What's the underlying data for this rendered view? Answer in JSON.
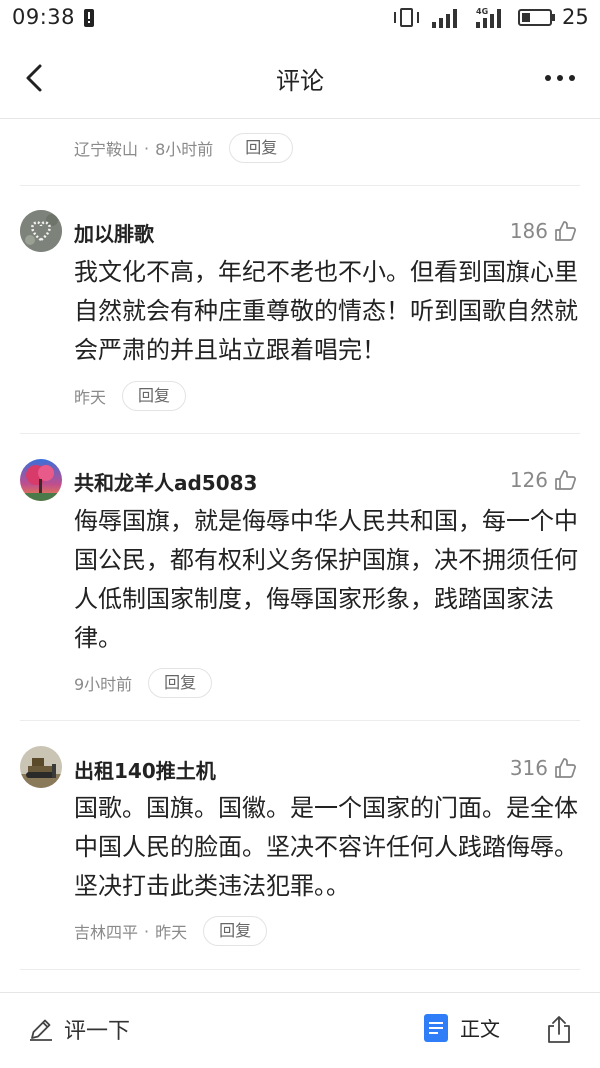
{
  "status_bar": {
    "time": "09:38",
    "battery_percent": "25",
    "network_label": "4G"
  },
  "header": {
    "title": "评论"
  },
  "top_meta": {
    "location": "辽宁鞍山",
    "time": "8小时前",
    "reply_label": "回复"
  },
  "comments": [
    {
      "username": "加以腓歌",
      "likes": "186",
      "text": "我文化不高，年纪不老也不小。但看到国旗心里自然就会有种庄重尊敬的情态！听到国歌自然就会严肃的并且站立跟着唱完！",
      "time": "昨天",
      "reply_label": "回复",
      "avatar_icon": "heart-pebbles-avatar"
    },
    {
      "username": "共和龙羊人ad5083",
      "likes": "126",
      "text": "侮辱国旗，就是侮辱中华人民共和国，每一个中国公民，都有权利义务保护国旗，决不拥须任何人低制国家制度，侮辱国家形象，践踏国家法律。",
      "time": "9小时前",
      "reply_label": "回复",
      "avatar_icon": "tree-sunset-avatar"
    },
    {
      "username": "出租140推土机",
      "likes": "316",
      "text": "国歌。国旗。国徽。是一个国家的门面。是全体中国人民的脸面。坚决不容许任何人践踏侮辱。坚决打击此类违法犯罪。。",
      "location": "吉林四平",
      "time": "昨天",
      "reply_label": "回复",
      "avatar_icon": "bulldozer-avatar"
    }
  ],
  "bottom_bar": {
    "comment_label": "评一下",
    "article_label": "正文"
  },
  "colors": {
    "accent": "#2f7ef7",
    "meta_text": "#8a8a8a",
    "divider": "#ececec"
  }
}
